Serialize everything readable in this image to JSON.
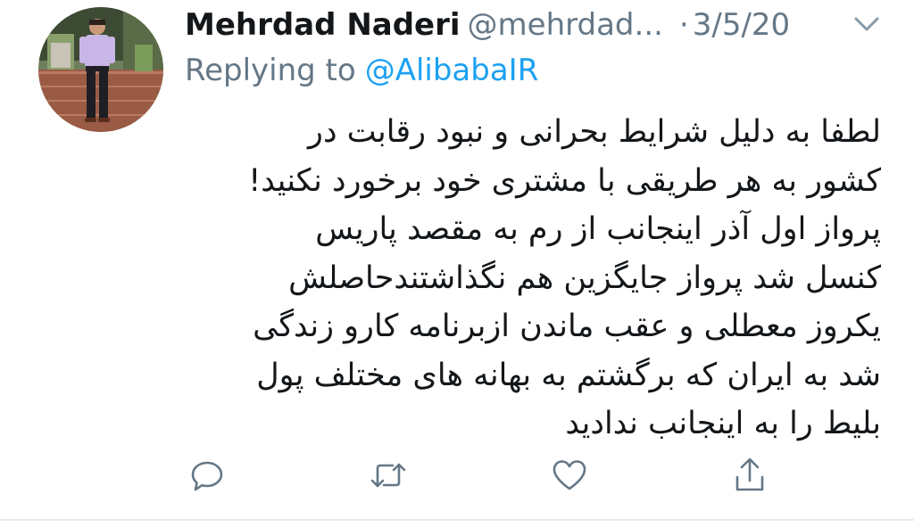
{
  "tweet": {
    "author": {
      "display_name": "Mehrdad Naderi",
      "handle": "@mehrdad...",
      "avatar": "profile-photo"
    },
    "date_separator": "·",
    "date": "3/5/20",
    "reply_prefix": "Replying to",
    "reply_to": "@AlibabaIR",
    "body_lines": [
      "لطفا به دلیل شرایط بحرانی و نبود رقابت در",
      "کشور به هر طریقی با مشتری خود برخورد نکنید!",
      "پرواز اول آذر اینجانب از رم به مقصد پاریس",
      "کنسل شد پرواز جایگزین هم نگذاشتندحاصلش",
      "یکروز معطلی و عقب ماندن ازبرنامه کارو زندگی",
      "شد به ایران که برگشتم به بهانه های مختلف پول",
      "بلیط را به اینجانب ندادید"
    ],
    "actions": [
      {
        "name": "reply",
        "icon": "reply-icon"
      },
      {
        "name": "retweet",
        "icon": "retweet-icon"
      },
      {
        "name": "like",
        "icon": "heart-icon"
      },
      {
        "name": "share",
        "icon": "share-icon"
      }
    ]
  },
  "colors": {
    "text_primary": "#14171a",
    "text_secondary": "#657786",
    "link": "#1da1f2",
    "divider": "#e6ecf0"
  }
}
